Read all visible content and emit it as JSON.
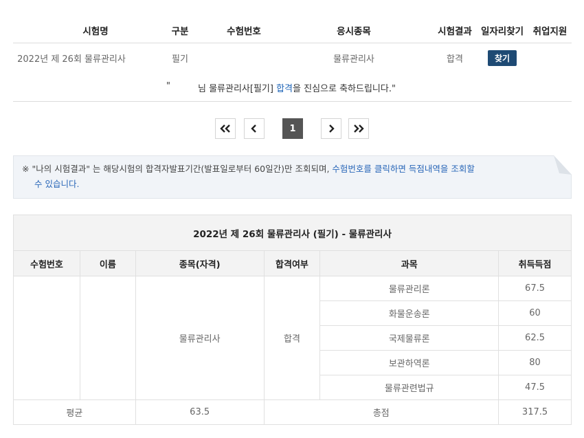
{
  "result_table": {
    "headers": {
      "exam_name": "시험명",
      "category": "구분",
      "exam_no": "수험번호",
      "exam_type": "응시종목",
      "result": "시험결과",
      "job_search": "일자리찾기",
      "employment": "취업지원"
    },
    "row": {
      "exam_name": "2022년 제 26회 물류관리사",
      "category": "필기",
      "exam_no": "",
      "exam_type": "물류관리사",
      "result": "합격",
      "find_button": "찾기"
    }
  },
  "congrats": {
    "open_quote": "\"",
    "prefix": "님 물류관리사[필기] ",
    "highlight": "합격",
    "suffix": "을 진심으로 축하드립니다.\""
  },
  "pagination": {
    "first": "«",
    "prev": "‹",
    "current": "1",
    "next": "›",
    "last": "»"
  },
  "notice": {
    "mark": "※",
    "line1_a": "\"나의 시험결과\" 는 해당시험의 합격자발표기간(발표일로부터 60일간)만 조회되며, ",
    "line1_b": "수험번호를 클릭하면 득점내역을 조회할",
    "line2": "수 있습니다."
  },
  "detail_table": {
    "title": "2022년 제 26회 물류관리사 (필기) - 물류관리사",
    "columns": {
      "exam_no": "수험번호",
      "name": "이름",
      "subject_type": "종목(자격)",
      "pass": "합격여부",
      "subject": "과목",
      "score": "취득득점"
    },
    "qualification": "물류관리사",
    "pass_status": "합격",
    "subjects": [
      {
        "name": "물류관리론",
        "score": "67.5"
      },
      {
        "name": "화물운송론",
        "score": "60"
      },
      {
        "name": "국제물류론",
        "score": "62.5"
      },
      {
        "name": "보관하역론",
        "score": "80"
      },
      {
        "name": "물류관련법규",
        "score": "47.5"
      }
    ],
    "footer": {
      "avg_label": "평균",
      "avg_value": "63.5",
      "total_label": "총점",
      "total_value": "317.5"
    }
  },
  "colors": {
    "button_bg": "#1e4a74",
    "highlight": "#1c63b7",
    "notice_bg": "#f1f4f8"
  }
}
